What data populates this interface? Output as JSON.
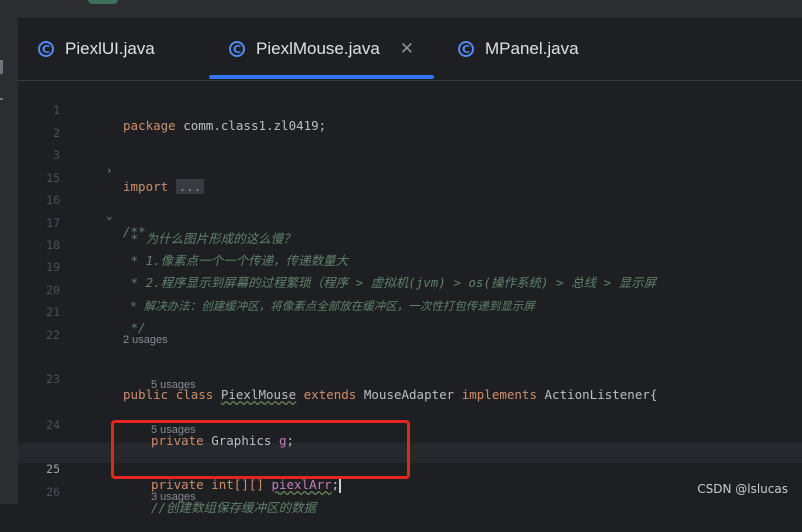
{
  "tabs": [
    {
      "label": "PiexlUI.java",
      "icon": "class-icon",
      "icon_letter": "C",
      "active": false
    },
    {
      "label": "PiexlMouse.java",
      "icon": "class-icon",
      "icon_letter": "C",
      "active": true,
      "close": "✕"
    },
    {
      "label": "MPanel.java",
      "icon": "class-icon",
      "icon_letter": "C",
      "active": false
    }
  ],
  "lines": {
    "l1": {
      "num": "1",
      "kw": "package",
      "text": " comm.class1.zl0419;"
    },
    "l2": {
      "num": "2"
    },
    "l3": {
      "num": "3",
      "kw": "import",
      "collapsed": "..."
    },
    "l15": {
      "num": "15"
    },
    "l16": {
      "num": "16",
      "text": "/**"
    },
    "l17": {
      "num": "17",
      "text": " * 为什么图片形成的这么慢？"
    },
    "l18": {
      "num": "18",
      "text": " * 1.像素点一个一个传递，传递数量大"
    },
    "l19": {
      "num": "19",
      "text": " * 2.程序显示到屏幕的过程繁琐（程序 > 虚拟机(jvm) > os(操作系统) > 总线 > 显示屏"
    },
    "l20": {
      "num": "20",
      "text": " * 解决办法：创建缓冲区，将像素点全部放在缓冲区，一次性打包传递到显示屏"
    },
    "l21": {
      "num": "21",
      "text": " */"
    },
    "l22": {
      "num": "22"
    },
    "l23": {
      "num": "23",
      "kw1": "public",
      "kw2": "class",
      "name": "PiexlMouse",
      "kw3": "extends",
      "parent": "MouseAdapter",
      "kw4": "implements",
      "iface": "ActionListener{"
    },
    "l24": {
      "num": "24",
      "kw": "private",
      "type": "Graphics",
      "field": "g",
      "end": ";"
    },
    "l25": {
      "num": "25",
      "kw": "private",
      "type": "int[][]",
      "field": "piexlArr",
      "end": ";"
    },
    "l26": {
      "num": "26",
      "text": "//创建数组保存缓冲区的数据"
    }
  },
  "hints": {
    "h23": "2 usages",
    "h24": "5 usages",
    "h25": "5 usages",
    "h26": "3 usages"
  },
  "watermark": "CSDN @lslucas"
}
